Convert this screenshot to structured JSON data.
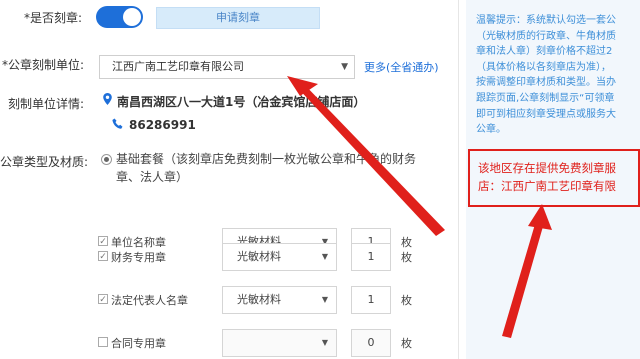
{
  "form": {
    "stamp_toggle_label": "*是否刻章:",
    "apply_button": "申请刻章",
    "unit_label": "*公章刻制单位:",
    "unit_selected": "江西广南工艺印章有限公司",
    "more_link": "更多(全省通办)",
    "unit_detail_label": "刻制单位详情:",
    "address": "南昌西湖区八一大道1号（冶金宾馆店铺店面）",
    "phone": "86286991",
    "type_label": "公章类型及材质:",
    "package_option": "基础套餐（该刻章店免费刻制一枚光敏公章和牛角的财务章、法人章）"
  },
  "seals": [
    {
      "name": "单位名称章",
      "checked": true,
      "material": "光敏材料",
      "qty": "1",
      "unit": "枚"
    },
    {
      "name": "财务专用章",
      "checked": true,
      "material": "光敏材料",
      "qty": "1",
      "unit": "枚"
    },
    {
      "name": "法定代表人名章",
      "checked": true,
      "material": "光敏材料",
      "qty": "1",
      "unit": "枚"
    },
    {
      "name": "合同专用章",
      "checked": false,
      "material": "",
      "qty": "0",
      "unit": "枚"
    }
  ],
  "side": {
    "tip": "温馨提示：系统默认勾选一套公\n（光敏材质的行政章、牛角材质\n章和法人章）刻章价格不超过2\n（具体价格以各刻章店为准），\n按需调整印章材质和类型。当办\n跟踪页面,公章刻制显示“可领章\n即可到相应刻章受理点或服务大\n公章。",
    "alert": "该地区存在提供免费刻章服\n店：江西广南工艺印章有限"
  },
  "colors": {
    "accent": "#1e6fd9",
    "alert": "#e0201b",
    "tip": "#3d8fd8"
  },
  "icons": [
    "map-pin-icon",
    "phone-icon",
    "caret-down-icon",
    "checkbox-icon",
    "radio-icon",
    "red-arrow-icon"
  ]
}
